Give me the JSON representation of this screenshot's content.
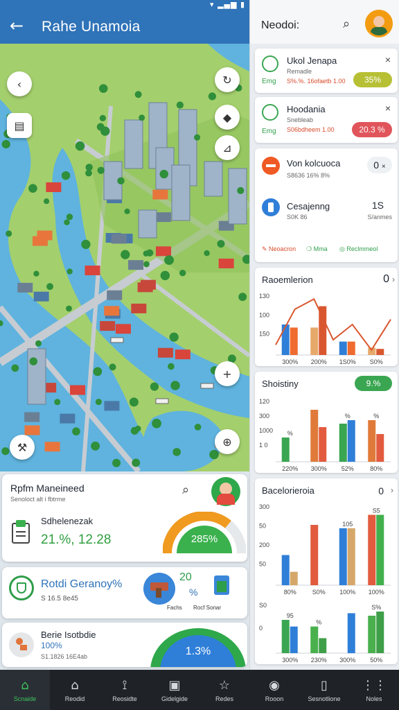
{
  "statusbar": {
    "icons": "▾ ▂▄▆ ▮"
  },
  "appbar": {
    "back_icon": "arrow-left-icon",
    "title": "Rahe Unamoia"
  },
  "map": {
    "colors": {
      "land": "#a4cf6d",
      "water": "#5fb3de",
      "road": "#c7ccd2"
    }
  },
  "card_rpm": {
    "title": "Rpfm Maneineed",
    "subtitle": "Senoloct alt i fbtrme",
    "label": "Sdhelenezak",
    "value": "21.%, 12.28",
    "gauge_value": "285%",
    "gauge_percent": 72
  },
  "card_green": {
    "title": "Rotdi Geranoy%",
    "subtitle": "S 16.5 8e45",
    "big_value": "20",
    "big_unit": "%",
    "label_a": "Fachs",
    "label_b": "Rocf Sonar"
  },
  "card_bottom": {
    "title": "Berie Isotbdie",
    "value": "100%",
    "subtitle": "S1.1826 16E4ab",
    "gauge_value": "1.3%"
  },
  "right_header": {
    "title": "Neodoi:"
  },
  "list_cards": [
    {
      "title": "Ukol Jenapa",
      "subtitle": "Remadle",
      "tag": "Emg",
      "value_line": "S%.%. 16ofaetb 1.00",
      "pill": "35%",
      "pill_color": "#b7c034"
    },
    {
      "title": "Hoodania",
      "subtitle": "Snebleab",
      "tag": "Emg",
      "value_line": "S06bdheem 1.00",
      "pill": "20.3 %",
      "pill_color": "#e0555b"
    },
    {
      "title": "Von kolcuoca",
      "subtitle": "S8636 16% 8%",
      "value": "0",
      "pill": ""
    },
    {
      "title": "Cesajenng",
      "subtitle": "S0K 86",
      "value": "1S",
      "side_label": "S/anmes",
      "actions": [
        "Neoacron",
        "Mma",
        "Reclmmeol"
      ]
    }
  ],
  "chart_a": {
    "title": "Raoemlerion",
    "value": "0"
  },
  "chart_b": {
    "title": "Shoistiny",
    "pill": "9.%"
  },
  "chart_c": {
    "title": "Bacelorieroia",
    "value": "0"
  },
  "chart_data": [
    {
      "type": "bar",
      "title": "Raoemlerion",
      "categories": [
        "300%",
        "200%",
        "1S0%",
        "S0%"
      ],
      "series": [
        {
          "values": [
            50,
            45,
            22,
            12
          ]
        },
        {
          "values": [
            45,
            80,
            22,
            10
          ]
        }
      ],
      "line": [
        20,
        90,
        110,
        30,
        60,
        10,
        70
      ],
      "ytick_labels": [
        "130",
        "100",
        "150"
      ],
      "colors": [
        "#2f7fd8",
        "#ef6b2f",
        "#e7a96a",
        "#d9572f"
      ]
    },
    {
      "type": "bar",
      "title": "Shoistiny",
      "categories": [
        "220%",
        "300%",
        "52%",
        "80%"
      ],
      "series": [
        {
          "values": [
            35,
            75,
            55,
            60
          ]
        },
        {
          "values": [
            0,
            50,
            60,
            40
          ]
        }
      ],
      "data_labels": [
        "%",
        "",
        "%",
        "%"
      ],
      "ytick_labels": [
        "120",
        "300",
        "1000",
        "1 0"
      ],
      "colors": [
        "#3aa651",
        "#2f7fd8",
        "#e07a3a",
        "#e25b3e"
      ]
    },
    {
      "type": "bar",
      "title": "Bacelorieroia",
      "categories": [
        "80%",
        "S0%",
        "100%",
        "100%"
      ],
      "series": [
        {
          "values": [
            45,
            90,
            85,
            105
          ]
        },
        {
          "values": [
            20,
            0,
            85,
            105
          ]
        }
      ],
      "data_labels": [
        "",
        "",
        "105",
        "S5"
      ],
      "ytick_labels": [
        "300",
        "50",
        "200",
        "50"
      ],
      "colors": [
        "#2f7fd8",
        "#d5a86a",
        "#e25b3e",
        "#42b04d"
      ]
    },
    {
      "type": "bar",
      "title": "",
      "categories": [
        "300%",
        "230%",
        "300%",
        "50%"
      ],
      "series": [
        {
          "values": [
            40,
            32,
            0,
            45
          ]
        },
        {
          "values": [
            32,
            18,
            48,
            50
          ]
        }
      ],
      "data_labels": [
        "95",
        "%",
        "",
        "S%"
      ],
      "ytick_labels": [
        "S0",
        "0"
      ],
      "colors": [
        "#3aa651",
        "#2f7fd8",
        "#49b04d",
        "#3f9f48"
      ]
    }
  ],
  "bottomnav": [
    {
      "icon": "home-icon",
      "glyph": "⌂",
      "label": "Scnaide",
      "active": true
    },
    {
      "icon": "house-alert-icon",
      "glyph": "⌂",
      "label": "Reodid"
    },
    {
      "icon": "eco-icon",
      "glyph": "⟟",
      "label": "Reosidte"
    },
    {
      "icon": "grid-icon",
      "glyph": "▣",
      "label": "Gidelgide"
    },
    {
      "icon": "star-icon",
      "glyph": "☆",
      "label": "Redes"
    },
    {
      "icon": "circle-icon",
      "glyph": "◉",
      "label": "Rooon"
    },
    {
      "icon": "trash-icon",
      "glyph": "▯",
      "label": "Sesnotlione"
    },
    {
      "icon": "apps-icon",
      "glyph": "⋮⋮",
      "label": "Noles"
    }
  ]
}
